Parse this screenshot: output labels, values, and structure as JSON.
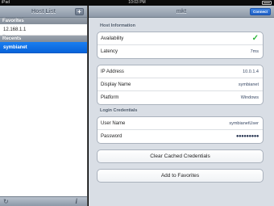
{
  "status_bar": {
    "carrier": "iPad",
    "time": "10:03 PM"
  },
  "left_panel": {
    "title": "Host List",
    "add_glyph": "+",
    "favorites_header": "Favorites",
    "favorites": [
      "12.168.1.1"
    ],
    "recents_header": "Recents",
    "recents": [
      "symbianet"
    ],
    "toolbar": {
      "refresh_icon": "refresh-icon",
      "info_glyph": "i"
    }
  },
  "detail": {
    "title": "mkt",
    "connect_label": "Connect",
    "host_info": {
      "header": "Host Information",
      "availability_label": "Availability",
      "availability_glyph": "✓",
      "latency_label": "Latency",
      "latency_value": "7ms"
    },
    "network": {
      "ip_label": "IP Address",
      "ip_value": "10.0.1.4",
      "display_name_label": "Display Name",
      "display_name_value": "symbianet",
      "platform_label": "Platform",
      "platform_value": "Windows"
    },
    "credentials": {
      "header": "Login Credentials",
      "username_label": "User Name",
      "username_value": "symbianetUser",
      "password_label": "Password",
      "password_value": "●●●●●●●●●"
    },
    "buttons": {
      "clear_cache": "Clear Cached Credentials",
      "add_favorites": "Add to Favorites"
    }
  },
  "colors": {
    "accent": "#0a6ee0",
    "check": "#2db63a"
  }
}
